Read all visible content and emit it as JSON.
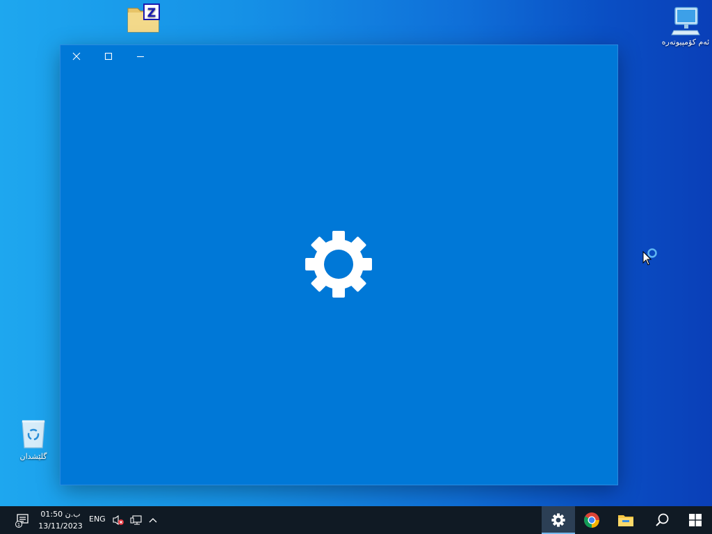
{
  "desktop": {
    "icons": {
      "this_pc": {
        "label": "ئەم کۆمپیوتەرە"
      },
      "recycle_bin": {
        "label": "گلێشدان"
      },
      "zip_folder": {
        "label": ""
      }
    }
  },
  "settings_window": {
    "controls": [
      "close",
      "maximize",
      "minimize"
    ],
    "state": "loading",
    "background": "#0078d7"
  },
  "taskbar": {
    "clock": {
      "time": "01:50 ب.ن",
      "date": "13/11/2023"
    },
    "language": "ENG",
    "tray_icons": [
      "speaker-muted-icon",
      "network-icon",
      "show-hidden-icons-chevron"
    ],
    "pinned_apps": [
      "settings",
      "google-chrome",
      "file-explorer",
      "search",
      "start"
    ],
    "active_app": "settings",
    "colors": {
      "bar": "#101a24",
      "active": "#2c3f55",
      "accent": "#76b9ed"
    }
  }
}
